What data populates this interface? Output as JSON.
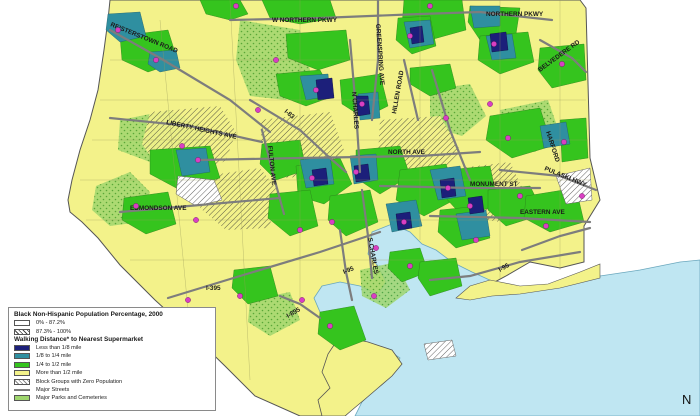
{
  "streets": {
    "w_northern": "W NORTHERN PKWY",
    "northern": "NORTHERN PKWY",
    "belvedere": "BELVEDERE RD",
    "reisterstown": "REISTERSTOWN ROAD",
    "greenspring": "GREENSPRING AVE",
    "liberty_heights": "LIBERTY HEIGHTS AVE",
    "n_charles": "N CHARLES",
    "hillen": "HILLEN ROAD",
    "harford": "HARFORD",
    "edmondson": "EDMONDSON AVE",
    "north_ave": "NORTH AVE",
    "monument": "MONUMENT ST",
    "pulaski": "PULASKI HWY",
    "eastern": "EASTERN AVE",
    "s_charles": "S CHARLES",
    "fulton": "FULTON AVE",
    "i83": "I-83",
    "i95": "I-95",
    "i95b": "I-95",
    "i895": "I-895",
    "i395": "I-395"
  },
  "legend": {
    "title_population": "Black Non-Hispanic Population Percentage, 2000",
    "pop_low": "0% - 87.2%",
    "pop_high": "87.3% - 100%",
    "title_walking": "Walking Distance* to Nearest Supermarket",
    "walk_1": "Less than 1/8 mile",
    "walk_2": "1/8 to 1/4 mile",
    "walk_3": "1/4 to 1/2 mile",
    "walk_4": "More than 1/2 mile",
    "zero_pop": "Block Groups with Zero Population",
    "major_streets": "Major Streets",
    "parks": "Major Parks and Cemeteries"
  },
  "compass": "N",
  "colors": {
    "more_than_half_mile": "#f3f28a",
    "quarter_to_half": "#35c41e",
    "eighth_to_quarter": "#2f8fa0",
    "less_than_eighth": "#1c1f7a",
    "water": "#bfe6f2",
    "supermarket": "#d93fc3",
    "major_streets": "#7d7d7d"
  },
  "supermarket_icon": "magenta-dot-icon"
}
